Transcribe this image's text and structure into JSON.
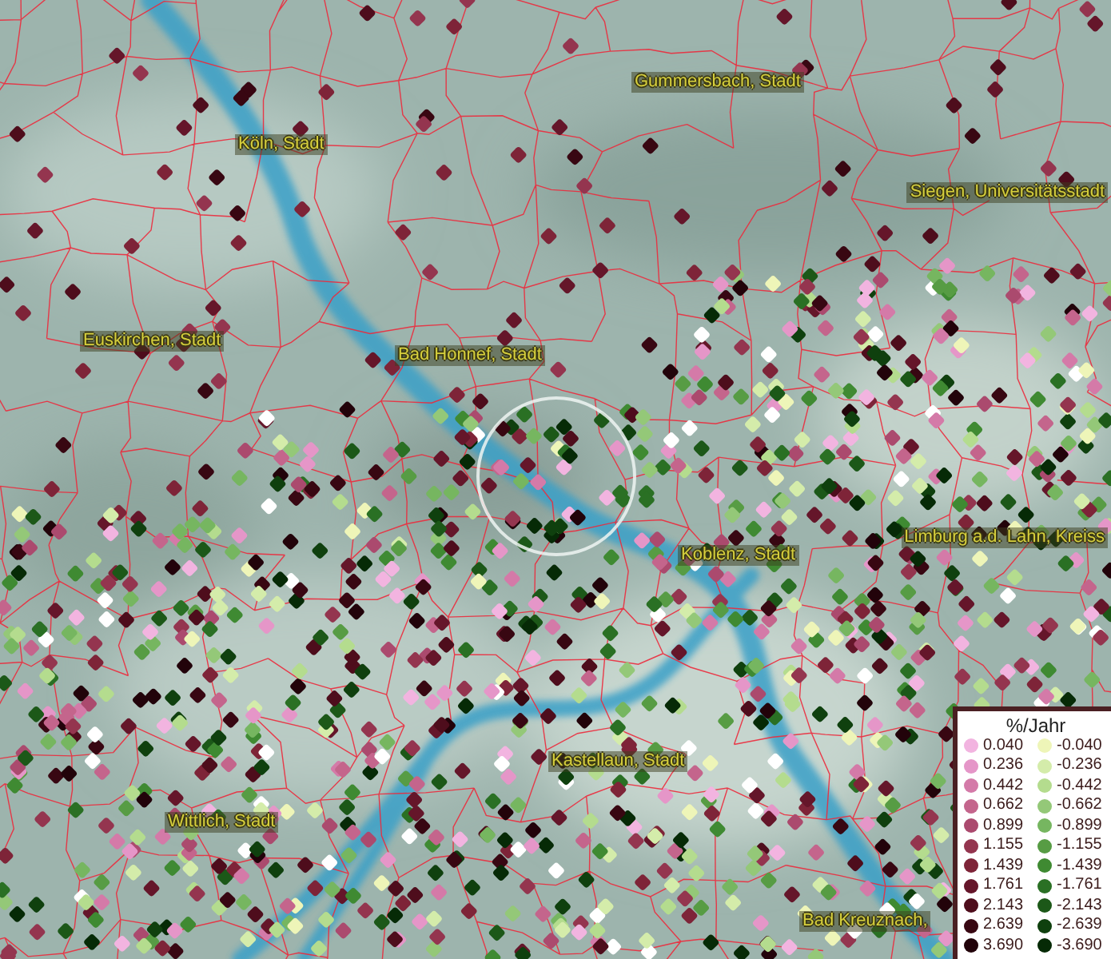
{
  "map": {
    "cities": [
      {
        "name": "Gummersbach, Stadt"
      },
      {
        "name": "Köln, Stadt"
      },
      {
        "name": "Siegen, Universitätsstadt"
      },
      {
        "name": "Euskirchen, Stadt"
      },
      {
        "name": "Bad Honnef, Stadt"
      },
      {
        "name": "Limburg a.d. Lahn, Kreiss"
      },
      {
        "name": "Koblenz, Stadt"
      },
      {
        "name": "Kastellaun, Stadt"
      },
      {
        "name": "Wittlich, Stadt"
      },
      {
        "name": "Bad Kreuznach,"
      }
    ]
  },
  "legend": {
    "title": "%/Jahr",
    "items": [
      {
        "label": "0.040",
        "color": "#f2b4e0"
      },
      {
        "label": "-0.040",
        "color": "#eef5b8"
      },
      {
        "label": "0.236",
        "color": "#e596c8"
      },
      {
        "label": "-0.236",
        "color": "#d4ecaa"
      },
      {
        "label": "0.442",
        "color": "#d47aa8"
      },
      {
        "label": "-0.442",
        "color": "#b4dc8e"
      },
      {
        "label": "0.662",
        "color": "#c4658c"
      },
      {
        "label": "-0.662",
        "color": "#94c878"
      },
      {
        "label": "0.899",
        "color": "#ab4a6e"
      },
      {
        "label": "-0.899",
        "color": "#76b660"
      },
      {
        "label": "1.155",
        "color": "#94354f"
      },
      {
        "label": "-1.155",
        "color": "#579c44"
      },
      {
        "label": "1.439",
        "color": "#7e2438"
      },
      {
        "label": "-1.439",
        "color": "#3f8a32"
      },
      {
        "label": "1.761",
        "color": "#65162a"
      },
      {
        "label": "-1.761",
        "color": "#2a7024"
      },
      {
        "label": "2.143",
        "color": "#4e0d1c"
      },
      {
        "label": "-2.143",
        "color": "#1c5818"
      },
      {
        "label": "2.639",
        "color": "#380712"
      },
      {
        "label": "-2.639",
        "color": "#0f400e"
      },
      {
        "label": "3.690",
        "color": "#22030a"
      },
      {
        "label": "-3.690",
        "color": "#062a06"
      }
    ]
  }
}
